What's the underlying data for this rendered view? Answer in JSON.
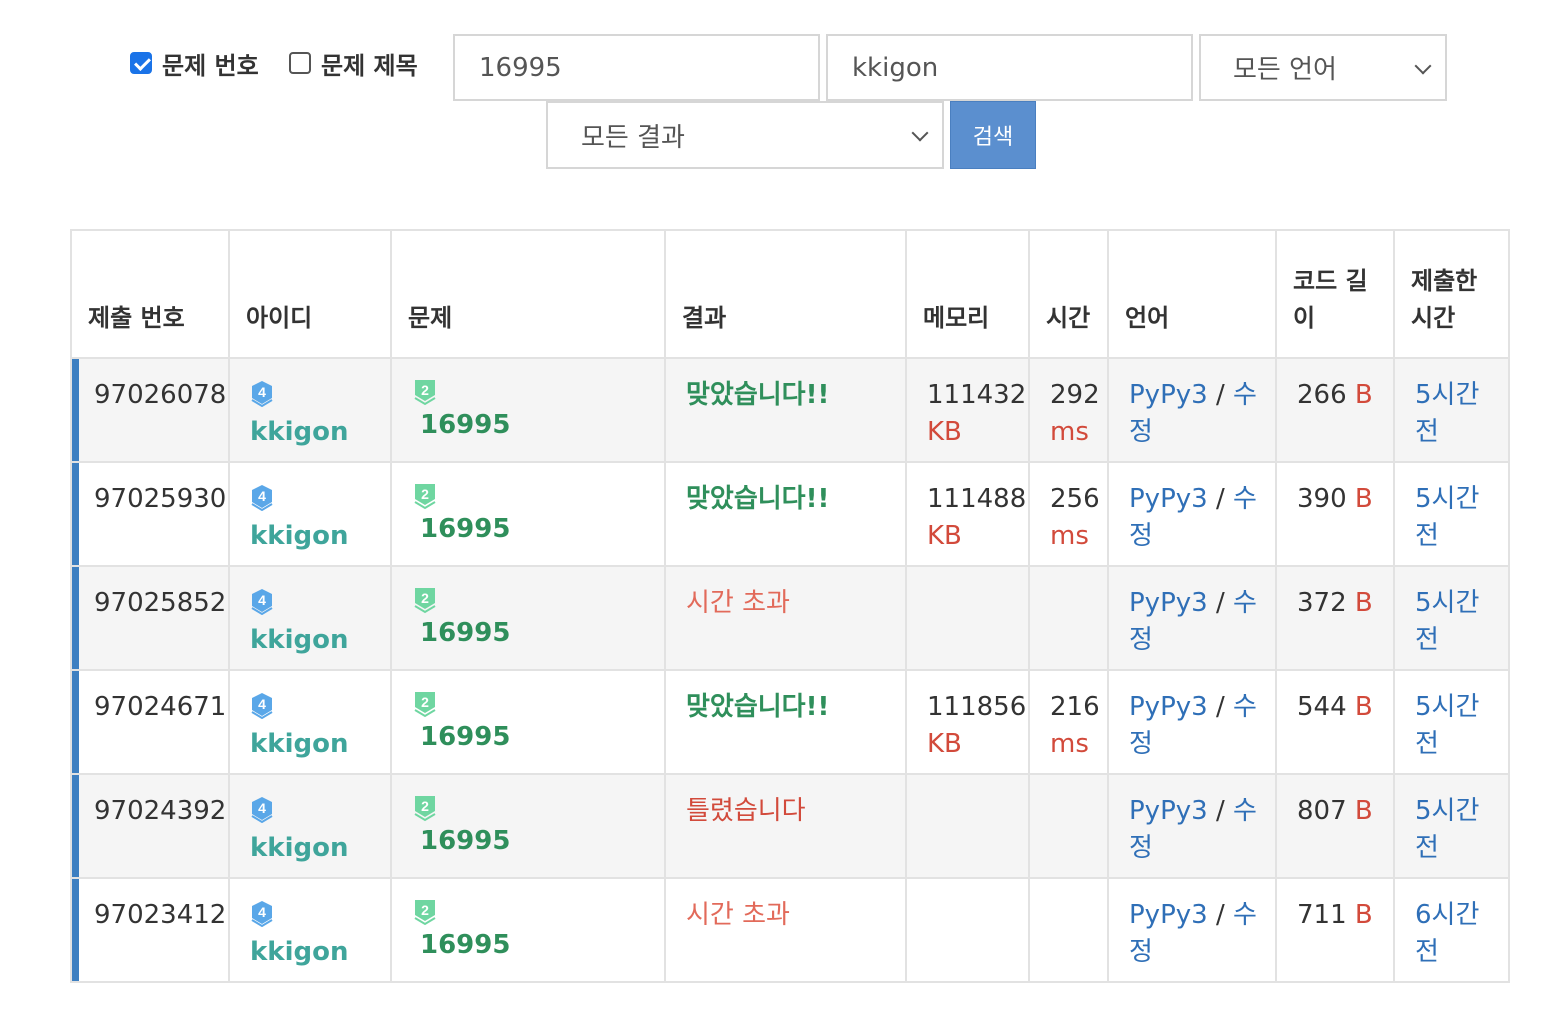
{
  "filters": {
    "problem_number": {
      "label": "문제 번호",
      "checked": true
    },
    "problem_title": {
      "label": "문제 제목",
      "checked": false
    },
    "problem_input": "16995",
    "user_input": "kkigon",
    "language_select": "모든 언어",
    "result_select": "모든 결과",
    "search_button": "검색"
  },
  "table": {
    "headers": [
      "제출 번호",
      "아이디",
      "문제",
      "결과",
      "메모리",
      "시간",
      "언어",
      "코드 길이",
      "제출한 시간"
    ],
    "rows": [
      {
        "id": "97026078",
        "user": "kkigon",
        "problem": "16995",
        "result": "맞았습니다!!",
        "result_type": "ac",
        "memory": "111432",
        "memory_unit": "KB",
        "time": "292",
        "time_unit": "ms",
        "lang": "PyPy3",
        "sep": " / ",
        "edit": "수정",
        "code": "266",
        "code_unit": "B",
        "submitted": "5시간 전"
      },
      {
        "id": "97025930",
        "user": "kkigon",
        "problem": "16995",
        "result": "맞았습니다!!",
        "result_type": "ac",
        "memory": "111488",
        "memory_unit": "KB",
        "time": "256",
        "time_unit": "ms",
        "lang": "PyPy3",
        "sep": " / ",
        "edit": "수정",
        "code": "390",
        "code_unit": "B",
        "submitted": "5시간 전"
      },
      {
        "id": "97025852",
        "user": "kkigon",
        "problem": "16995",
        "result": "시간 초과",
        "result_type": "tle",
        "memory": "",
        "memory_unit": "",
        "time": "",
        "time_unit": "",
        "lang": "PyPy3",
        "sep": " / ",
        "edit": "수정",
        "code": "372",
        "code_unit": "B",
        "submitted": "5시간 전"
      },
      {
        "id": "97024671",
        "user": "kkigon",
        "problem": "16995",
        "result": "맞았습니다!!",
        "result_type": "ac",
        "memory": "111856",
        "memory_unit": "KB",
        "time": "216",
        "time_unit": "ms",
        "lang": "PyPy3",
        "sep": " / ",
        "edit": "수정",
        "code": "544",
        "code_unit": "B",
        "submitted": "5시간 전"
      },
      {
        "id": "97024392",
        "user": "kkigon",
        "problem": "16995",
        "result": "틀렸습니다",
        "result_type": "wa",
        "memory": "",
        "memory_unit": "",
        "time": "",
        "time_unit": "",
        "lang": "PyPy3",
        "sep": " / ",
        "edit": "수정",
        "code": "807",
        "code_unit": "B",
        "submitted": "5시간 전"
      },
      {
        "id": "97023412",
        "user": "kkigon",
        "problem": "16995",
        "result": "시간 초과",
        "result_type": "tle",
        "memory": "",
        "memory_unit": "",
        "time": "",
        "time_unit": "",
        "lang": "PyPy3",
        "sep": " / ",
        "edit": "수정",
        "code": "711",
        "code_unit": "B",
        "submitted": "6시간 전"
      }
    ]
  },
  "badges": {
    "user_level": "4",
    "problem_tier": "2"
  },
  "colors": {
    "accent": "#5b8fcf",
    "accepted": "#2f8f5b",
    "time_limit": "#e26a5a",
    "wrong": "#d24a3b",
    "user": "#3fa59b",
    "link": "#2f6fb7",
    "row_marker": "#3d7fc1"
  }
}
